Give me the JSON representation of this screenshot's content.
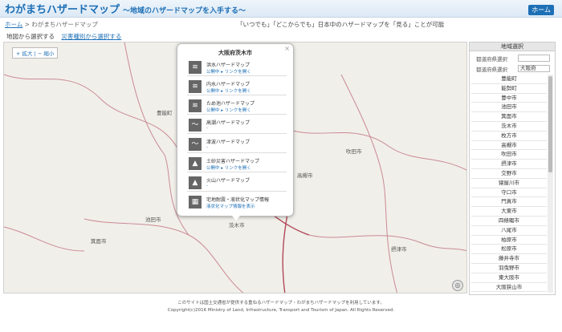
{
  "header": {
    "title": "わがまちハザードマップ",
    "subtitle": "〜地域のハザードマップを入手する〜",
    "home_button": "ホーム"
  },
  "breadcrumb": {
    "home": "ホーム",
    "separator": ">",
    "current": "わがまちハザードマップ"
  },
  "tagline": "「いつでも」「どこからでも」日本中のハザードマップを「見る」ことが可能",
  "nav": {
    "search_map": "地図から選択する",
    "search_disaster": "災害種別から選択する"
  },
  "map": {
    "zoom_label": "+ 拡大 | − 縮小",
    "labels": [
      "豊能町",
      "池田市",
      "箕面市",
      "茨木市",
      "高槻市",
      "吹田市",
      "摂津市"
    ],
    "pin_symbol": "◎"
  },
  "popup": {
    "title": "大阪府茨木市",
    "close": "×",
    "items": [
      {
        "icon": "≋",
        "name": "洪水ハザードマップ",
        "sub": "公開中 ▸ リンクを開く"
      },
      {
        "icon": "≋",
        "name": "内水ハザードマップ",
        "sub": "公開中 ▸ リンクを開く"
      },
      {
        "icon": "≋",
        "name": "ため池ハザードマップ",
        "sub": "公開中 ▸ リンクを開く"
      },
      {
        "icon": "〜",
        "name": "高潮ハザードマップ",
        "sub": "-"
      },
      {
        "icon": "〜",
        "name": "津波ハザードマップ",
        "sub": "-"
      },
      {
        "icon": "▲",
        "name": "土砂災害ハザードマップ",
        "sub": "公開中 ▸ リンクを開く"
      },
      {
        "icon": "▲",
        "name": "火山ハザードマップ",
        "sub": "-"
      },
      {
        "icon": "▦",
        "name": "宅地耐震・液状化マップ情報",
        "sub": "液状化マップ情報を表示"
      }
    ]
  },
  "sidebar": {
    "title": "地域選択",
    "pref_label": "都道府県選択",
    "pref_value": "",
    "muni_label": "都道府県選択",
    "muni_value": "大阪府",
    "municipalities": [
      "豊能町",
      "能勢町",
      "豊中市",
      "池田市",
      "箕面市",
      "茨木市",
      "枚方市",
      "高槻市",
      "吹田市",
      "摂津市",
      "交野市",
      "寝屋川市",
      "守口市",
      "門真市",
      "大東市",
      "四條畷市",
      "八尾市",
      "柏原市",
      "松原市",
      "藤井寺市",
      "羽曳野市",
      "東大阪市",
      "大阪狭山市",
      "富田林市"
    ]
  },
  "footer": {
    "line1": "このサイトは国土交通省が提供する重ねるハザードマップ・わがまちハザードマップを利用しています。",
    "line2": "Copyright(c)2016 Ministry of Land, Infrastructure, Transport and Tourism of Japan. All Rights Reserved."
  },
  "colors": {
    "accent": "#1d6fb5",
    "map_bg": "#f1efe9",
    "boundary": "#b04a5a"
  }
}
